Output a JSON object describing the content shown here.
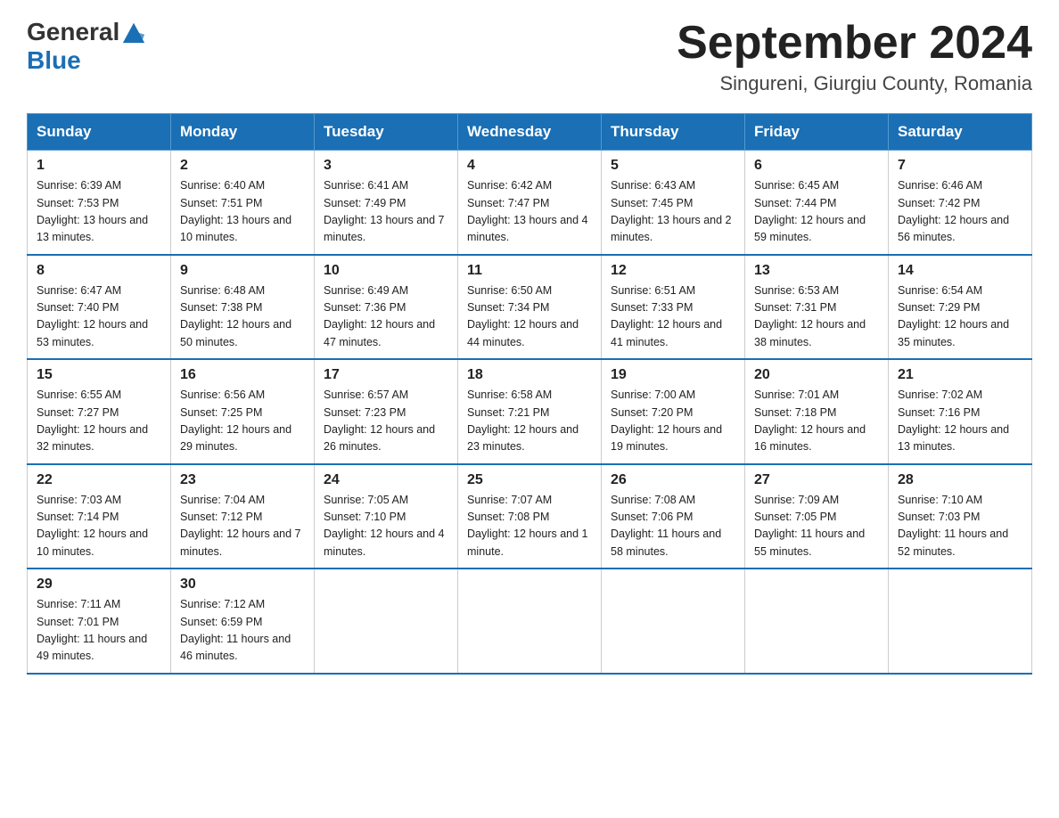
{
  "header": {
    "logo_general": "General",
    "logo_blue": "Blue",
    "month_title": "September 2024",
    "location": "Singureni, Giurgiu County, Romania"
  },
  "days_of_week": [
    "Sunday",
    "Monday",
    "Tuesday",
    "Wednesday",
    "Thursday",
    "Friday",
    "Saturday"
  ],
  "weeks": [
    [
      {
        "day": "1",
        "sunrise": "6:39 AM",
        "sunset": "7:53 PM",
        "daylight": "13 hours and 13 minutes."
      },
      {
        "day": "2",
        "sunrise": "6:40 AM",
        "sunset": "7:51 PM",
        "daylight": "13 hours and 10 minutes."
      },
      {
        "day": "3",
        "sunrise": "6:41 AM",
        "sunset": "7:49 PM",
        "daylight": "13 hours and 7 minutes."
      },
      {
        "day": "4",
        "sunrise": "6:42 AM",
        "sunset": "7:47 PM",
        "daylight": "13 hours and 4 minutes."
      },
      {
        "day": "5",
        "sunrise": "6:43 AM",
        "sunset": "7:45 PM",
        "daylight": "13 hours and 2 minutes."
      },
      {
        "day": "6",
        "sunrise": "6:45 AM",
        "sunset": "7:44 PM",
        "daylight": "12 hours and 59 minutes."
      },
      {
        "day": "7",
        "sunrise": "6:46 AM",
        "sunset": "7:42 PM",
        "daylight": "12 hours and 56 minutes."
      }
    ],
    [
      {
        "day": "8",
        "sunrise": "6:47 AM",
        "sunset": "7:40 PM",
        "daylight": "12 hours and 53 minutes."
      },
      {
        "day": "9",
        "sunrise": "6:48 AM",
        "sunset": "7:38 PM",
        "daylight": "12 hours and 50 minutes."
      },
      {
        "day": "10",
        "sunrise": "6:49 AM",
        "sunset": "7:36 PM",
        "daylight": "12 hours and 47 minutes."
      },
      {
        "day": "11",
        "sunrise": "6:50 AM",
        "sunset": "7:34 PM",
        "daylight": "12 hours and 44 minutes."
      },
      {
        "day": "12",
        "sunrise": "6:51 AM",
        "sunset": "7:33 PM",
        "daylight": "12 hours and 41 minutes."
      },
      {
        "day": "13",
        "sunrise": "6:53 AM",
        "sunset": "7:31 PM",
        "daylight": "12 hours and 38 minutes."
      },
      {
        "day": "14",
        "sunrise": "6:54 AM",
        "sunset": "7:29 PM",
        "daylight": "12 hours and 35 minutes."
      }
    ],
    [
      {
        "day": "15",
        "sunrise": "6:55 AM",
        "sunset": "7:27 PM",
        "daylight": "12 hours and 32 minutes."
      },
      {
        "day": "16",
        "sunrise": "6:56 AM",
        "sunset": "7:25 PM",
        "daylight": "12 hours and 29 minutes."
      },
      {
        "day": "17",
        "sunrise": "6:57 AM",
        "sunset": "7:23 PM",
        "daylight": "12 hours and 26 minutes."
      },
      {
        "day": "18",
        "sunrise": "6:58 AM",
        "sunset": "7:21 PM",
        "daylight": "12 hours and 23 minutes."
      },
      {
        "day": "19",
        "sunrise": "7:00 AM",
        "sunset": "7:20 PM",
        "daylight": "12 hours and 19 minutes."
      },
      {
        "day": "20",
        "sunrise": "7:01 AM",
        "sunset": "7:18 PM",
        "daylight": "12 hours and 16 minutes."
      },
      {
        "day": "21",
        "sunrise": "7:02 AM",
        "sunset": "7:16 PM",
        "daylight": "12 hours and 13 minutes."
      }
    ],
    [
      {
        "day": "22",
        "sunrise": "7:03 AM",
        "sunset": "7:14 PM",
        "daylight": "12 hours and 10 minutes."
      },
      {
        "day": "23",
        "sunrise": "7:04 AM",
        "sunset": "7:12 PM",
        "daylight": "12 hours and 7 minutes."
      },
      {
        "day": "24",
        "sunrise": "7:05 AM",
        "sunset": "7:10 PM",
        "daylight": "12 hours and 4 minutes."
      },
      {
        "day": "25",
        "sunrise": "7:07 AM",
        "sunset": "7:08 PM",
        "daylight": "12 hours and 1 minute."
      },
      {
        "day": "26",
        "sunrise": "7:08 AM",
        "sunset": "7:06 PM",
        "daylight": "11 hours and 58 minutes."
      },
      {
        "day": "27",
        "sunrise": "7:09 AM",
        "sunset": "7:05 PM",
        "daylight": "11 hours and 55 minutes."
      },
      {
        "day": "28",
        "sunrise": "7:10 AM",
        "sunset": "7:03 PM",
        "daylight": "11 hours and 52 minutes."
      }
    ],
    [
      {
        "day": "29",
        "sunrise": "7:11 AM",
        "sunset": "7:01 PM",
        "daylight": "11 hours and 49 minutes."
      },
      {
        "day": "30",
        "sunrise": "7:12 AM",
        "sunset": "6:59 PM",
        "daylight": "11 hours and 46 minutes."
      },
      null,
      null,
      null,
      null,
      null
    ]
  ]
}
